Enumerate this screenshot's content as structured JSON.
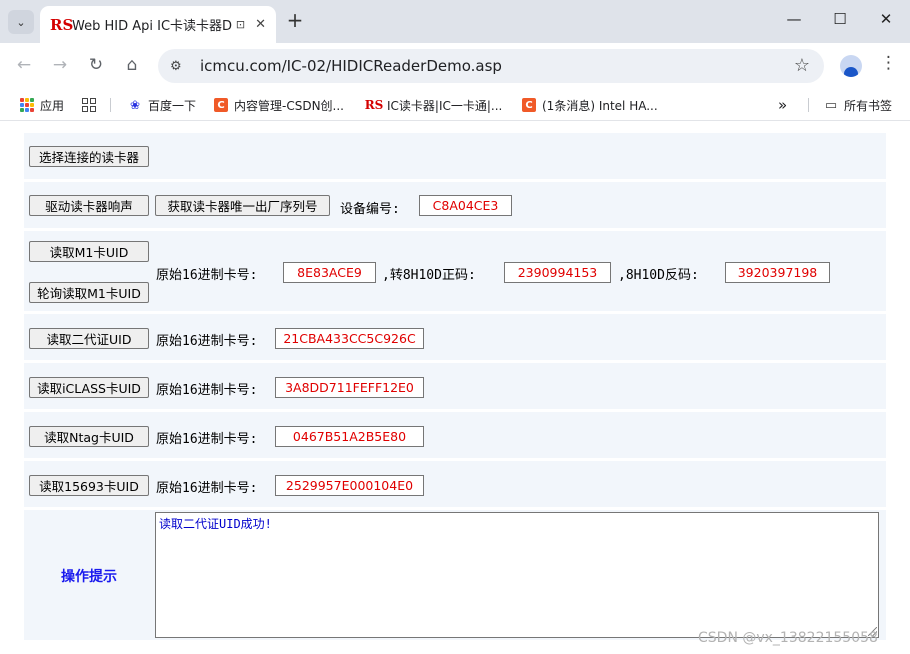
{
  "browser": {
    "tab_favicon": "RS",
    "tab_title": "Web HID Api IC卡读卡器D",
    "new_tab_symbol": "+",
    "tab_menu_symbol": "⌄",
    "url": "icmcu.com/IC-02/HIDICReaderDemo.asp"
  },
  "bookmarks": {
    "items": [
      {
        "label": "应用"
      },
      {
        "label": "百度一下"
      },
      {
        "label": "内容管理-CSDN创..."
      },
      {
        "label": "IC读卡器|IC一卡通|..."
      },
      {
        "label": "(1条消息) Intel HA..."
      }
    ],
    "overflow_symbol": "»",
    "all_bookmarks": "所有书签"
  },
  "page": {
    "select_reader_button": "选择连接的读卡器",
    "beep_button": "驱动读卡器响声",
    "get_serial_button": "获取读卡器唯一出厂序列号",
    "device_no_label": "设备编号:",
    "device_no_value": "C8A04CE3",
    "read_m1_button": "读取M1卡UID",
    "poll_m1_button": "轮询读取M1卡UID",
    "raw_hex_label": "原始16进制卡号:",
    "m1_hex_value": "8E83ACE9",
    "to_8h10d_label": ",转8H10D正码:",
    "m1_8h10d_value": "2390994153",
    "reverse_8h10d_label": ",8H10D反码:",
    "m1_reverse_value": "3920397198",
    "read_idcard_button": "读取二代证UID",
    "idcard_value": "21CBA433CC5C926C",
    "read_iclass_button": "读取iCLASS卡UID",
    "iclass_value": "3A8DD711FEFF12E0",
    "read_ntag_button": "读取Ntag卡UID",
    "ntag_value": "0467B51A2B5E80",
    "read_15693_button": "读取15693卡UID",
    "iso15693_value": "2529957E000104E0",
    "hint_label": "操作提示",
    "hint_text": "读取二代证UID成功!"
  },
  "watermark": "CSDN @vx_13822155058",
  "colors": {
    "value_text": "#e00000",
    "hint_label": "#1a1aee",
    "hint_text": "#0000cc",
    "row_background": "#f2f6fb"
  }
}
